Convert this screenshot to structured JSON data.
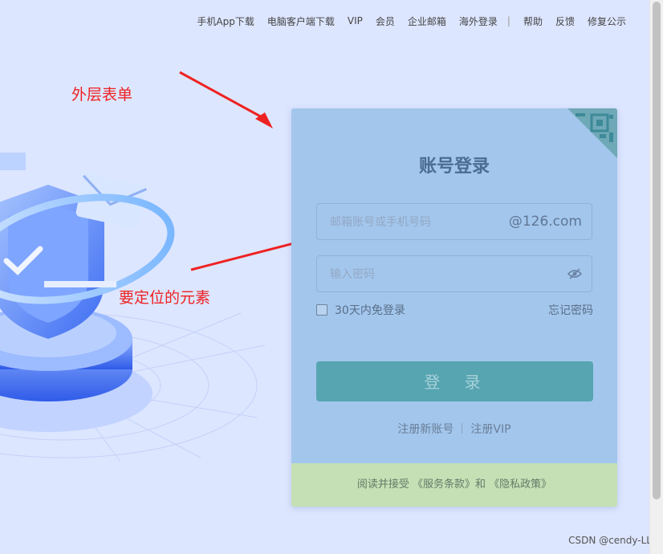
{
  "topnav": {
    "links": [
      "手机App下载",
      "电脑客户端下载",
      "VIP",
      "会员",
      "企业邮箱",
      "海外登录",
      "帮助",
      "反馈",
      "修复公示"
    ],
    "separator": "|"
  },
  "annotations": {
    "outer_form": "外层表单",
    "target_element": "要定位的元素"
  },
  "login": {
    "title": "账号登录",
    "email_placeholder": "邮箱账号或手机号码",
    "email_suffix": "@126.com",
    "password_placeholder": "输入密码",
    "remember_label": "30天内免登录",
    "forgot_label": "忘记密码",
    "submit_label": "登 录",
    "register_label": "注册新账号",
    "register_vip_label": "注册VIP",
    "agreement_prefix": "阅读并接受",
    "terms_link": "《服务条款》",
    "agreement_and": "和",
    "privacy_link": "《隐私政策》"
  },
  "icons": {
    "qr": "qr-code-icon",
    "eye": "eye-off-icon",
    "illustration": "security-shield-illustration"
  },
  "colors": {
    "page_bg": "#dde6ff",
    "outer_form_bg": "#a3c6ec",
    "login_button": "#56a5b1",
    "agreement_bg": "#c5e0b4",
    "annotation": "#ee2222"
  },
  "watermark": "CSDN @cendy-LL"
}
